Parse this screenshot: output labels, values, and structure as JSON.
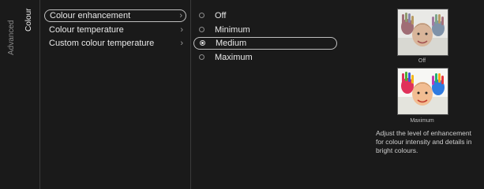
{
  "nav": {
    "advanced_label": "Advanced",
    "colour_label": "Colour"
  },
  "menu": {
    "items": [
      {
        "label": "Colour enhancement",
        "selected": true
      },
      {
        "label": "Colour temperature",
        "selected": false
      },
      {
        "label": "Custom colour temperature",
        "selected": false
      }
    ],
    "chevron_icon": "chevron-right-icon"
  },
  "options": {
    "items": [
      {
        "label": "Off",
        "checked": false
      },
      {
        "label": "Minimum",
        "checked": false
      },
      {
        "label": "Medium",
        "checked": true
      },
      {
        "label": "Maximum",
        "checked": false
      }
    ]
  },
  "preview": {
    "off_caption": "Off",
    "max_caption": "Maximum",
    "description_lines": [
      "Adjust the level of enhancement",
      "for colour intensity and details in",
      "bright colours."
    ]
  },
  "colors": {
    "background": "#1a1a1a",
    "text": "#e8e8e8",
    "highlight_border": "#bfbfbf"
  }
}
